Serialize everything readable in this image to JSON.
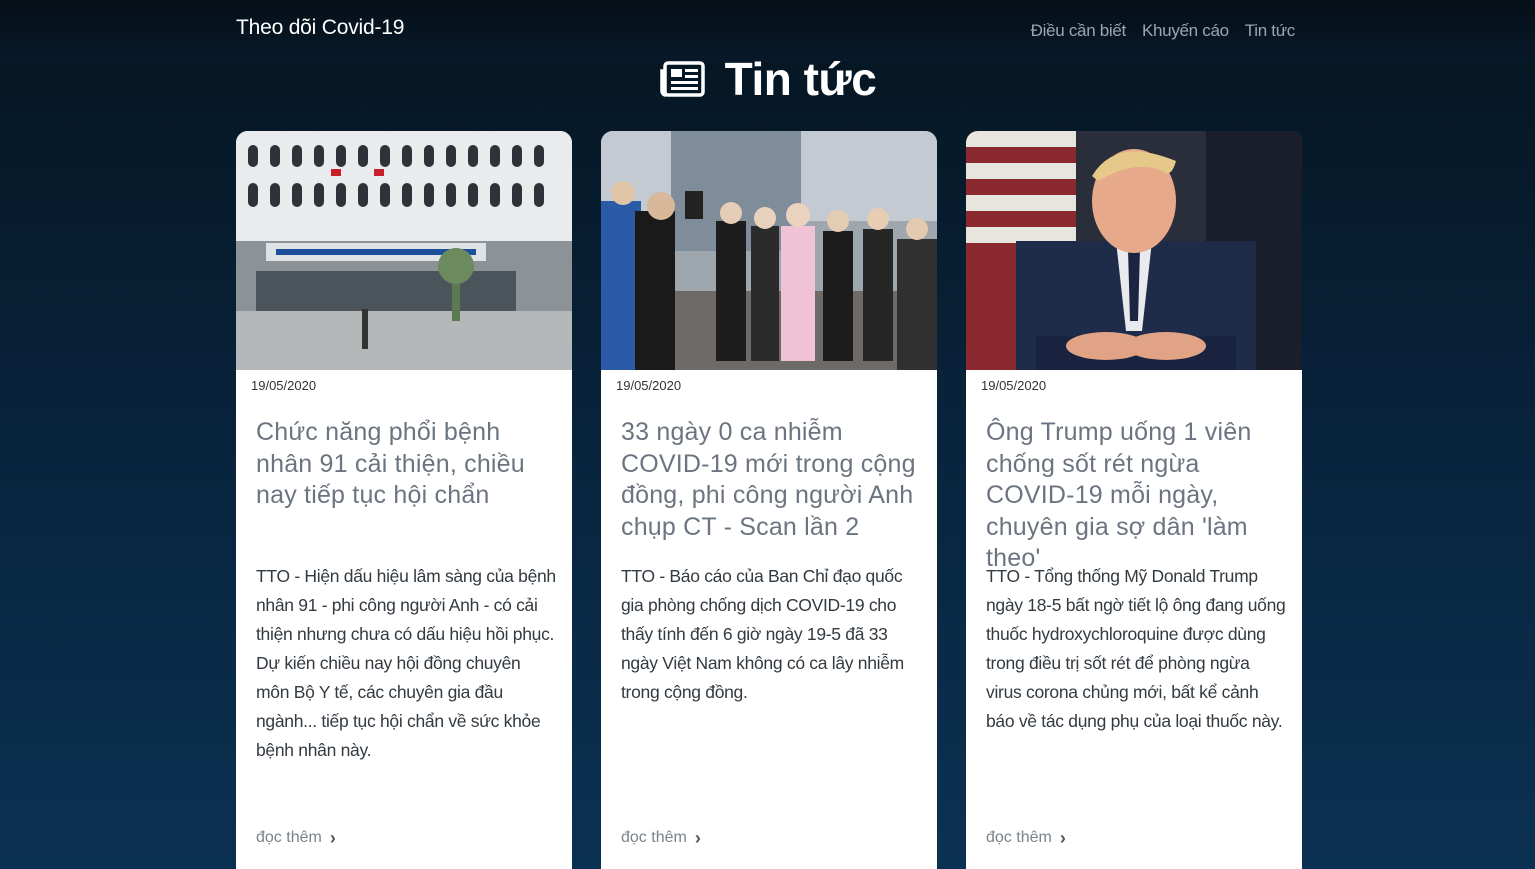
{
  "nav": {
    "brand": "Theo dõi Covid-19",
    "links": [
      "Điều cần biết",
      "Khuyến cáo",
      "Tin tức"
    ]
  },
  "section": {
    "icon": "newspaper-icon",
    "title": "Tin tức"
  },
  "cards": [
    {
      "date": "19/05/2020",
      "title": "Chức năng phổi bệnh nhân 91 cải thiện, chiều nay tiếp tục hội chẩn",
      "summary": "TTO - Hiện dấu hiệu lâm sàng của bệnh nhân 91 - phi công người Anh - có cải thiện nhưng chưa có dấu hiệu hồi phục. Dự kiến chiều nay hội đồng chuyên môn Bộ Y tế, các chuyên gia đầu ngành... tiếp tục hội chẩn về sức khỏe bệnh nhân này.",
      "read_more": "đọc thêm",
      "image_subject": "hospital-building-photo"
    },
    {
      "date": "19/05/2020",
      "title": "33 ngày 0 ca nhiễm COVID-19 mới trong cộng đồng, phi công người Anh chụp CT - Scan lần 2",
      "summary": "TTO - Báo cáo của Ban Chỉ đạo quốc gia phòng chống dịch COVID-19 cho thấy tính đến 6 giờ ngày 19-5 đã 33 ngày Việt Nam không có ca lây nhiễm trong cộng đồng.",
      "read_more": "đọc thêm",
      "image_subject": "airport-travelers-photo"
    },
    {
      "date": "19/05/2020",
      "title": "Ông Trump uống 1 viên chống sốt rét ngừa COVID-19 mỗi ngày, chuyên gia sợ dân 'làm theo'",
      "summary": "TTO - Tổng thống Mỹ Donald Trump ngày 18-5 bất ngờ tiết lộ ông đang uống thuốc hydroxychloroquine được dùng trong điều trị sốt rét để phòng ngừa virus corona chủng mới, bất kể cảnh báo về tác dụng phụ của loại thuốc này.",
      "read_more": "đọc thêm",
      "image_subject": "portrait-photo"
    }
  ]
}
